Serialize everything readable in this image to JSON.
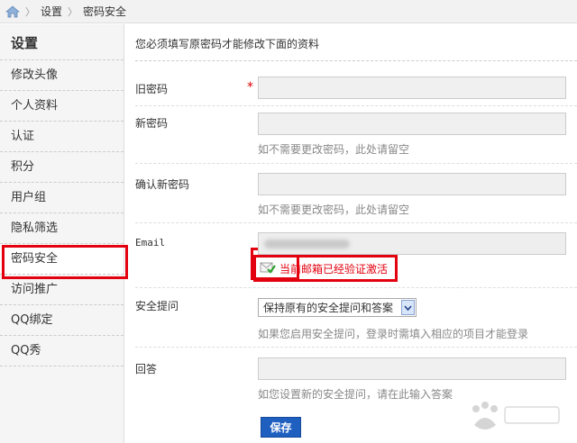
{
  "breadcrumb": {
    "home_icon": "home-icon",
    "items": [
      "设置",
      "密码安全"
    ]
  },
  "sidebar": {
    "title": "设置",
    "items": [
      {
        "label": "修改头像"
      },
      {
        "label": "个人资料"
      },
      {
        "label": "认证"
      },
      {
        "label": "积分"
      },
      {
        "label": "用户组"
      },
      {
        "label": "隐私筛选"
      },
      {
        "label": "密码安全",
        "active": true
      },
      {
        "label": "访问推广"
      },
      {
        "label": "QQ绑定"
      },
      {
        "label": "QQ秀"
      }
    ]
  },
  "form": {
    "notice": "您必须填写原密码才能修改下面的资料",
    "old_password": {
      "label": "旧密码",
      "required": "*",
      "value": ""
    },
    "new_password": {
      "label": "新密码",
      "value": "",
      "hint": "如不需要更改密码，此处请留空"
    },
    "confirm_password": {
      "label": "确认新密码",
      "value": "",
      "hint": "如不需要更改密码，此处请留空"
    },
    "email": {
      "label": "Email",
      "status": "当前邮箱已经验证激活"
    },
    "security_question": {
      "label": "安全提问",
      "selected": "保持原有的安全提问和答案",
      "hint": "如果您启用安全提问，登录时需填入相应的项目才能登录"
    },
    "answer": {
      "label": "回答",
      "value": "",
      "hint": "如您设置新的安全提问，请在此输入答案"
    },
    "save_label": "保存"
  },
  "colors": {
    "accent": "#1f5fc0",
    "highlight": "#e3000f",
    "verified": "#e3000f"
  }
}
